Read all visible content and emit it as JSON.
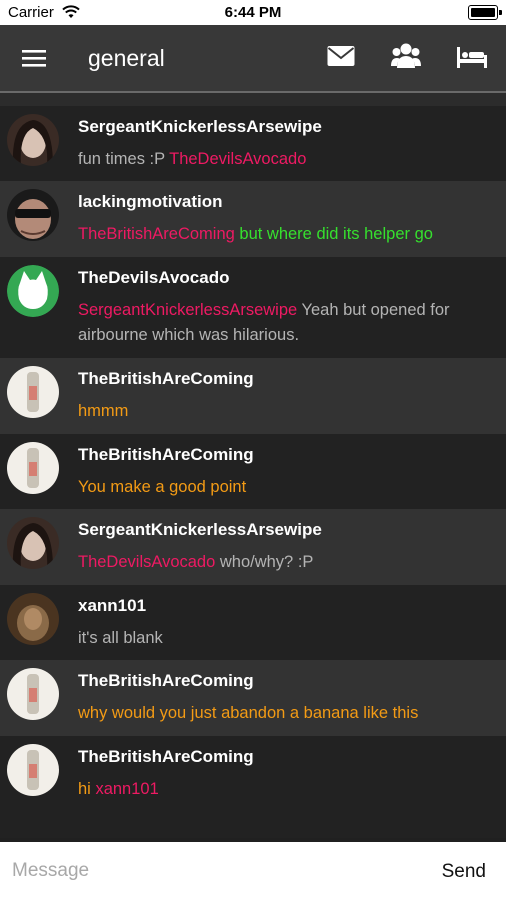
{
  "status_bar": {
    "carrier": "Carrier",
    "time": "6:44 PM"
  },
  "header": {
    "title": "general",
    "icons": [
      "menu-icon",
      "mail-icon",
      "users-icon",
      "bed-icon"
    ]
  },
  "colors": {
    "mention": "#ee1a63",
    "green": "#36e02e",
    "orange": "#f39b15",
    "text": "#b4b4b4"
  },
  "messages": [
    {
      "username": "SergeantKnickerlessArsewipe",
      "avatar": "dark-hair-photo",
      "parts": [
        {
          "text": "fun times :P ",
          "style": "gray"
        },
        {
          "text": "TheDevilsAvocado",
          "style": "pink"
        }
      ]
    },
    {
      "username": "lackingmotivation",
      "avatar": "sunglasses-photo",
      "parts": [
        {
          "text": "TheBritishAreComing",
          "style": "pink"
        },
        {
          "text": " but where did its helper go",
          "style": "green"
        }
      ]
    },
    {
      "username": "TheDevilsAvocado",
      "avatar": "green-cat-logo",
      "parts": [
        {
          "text": "SergeantKnickerlessArsewipe",
          "style": "pink"
        },
        {
          "text": " Yeah but opened for airbourne which was hilarious.",
          "style": "gray"
        }
      ]
    },
    {
      "username": "TheBritishAreComing",
      "avatar": "bottle-photo",
      "parts": [
        {
          "text": "hmmm",
          "style": "orange"
        }
      ]
    },
    {
      "username": "TheBritishAreComing",
      "avatar": "bottle-photo",
      "parts": [
        {
          "text": "You make a good point",
          "style": "orange"
        }
      ]
    },
    {
      "username": "SergeantKnickerlessArsewipe",
      "avatar": "dark-hair-photo",
      "parts": [
        {
          "text": "TheDevilsAvocado",
          "style": "pink"
        },
        {
          "text": " who/why? :P",
          "style": "gray"
        }
      ]
    },
    {
      "username": "xann101",
      "avatar": "brown-photo",
      "parts": [
        {
          "text": "it's all blank",
          "style": "gray"
        }
      ]
    },
    {
      "username": "TheBritishAreComing",
      "avatar": "bottle-photo",
      "parts": [
        {
          "text": "why would you just abandon a banana like this",
          "style": "orange"
        }
      ]
    },
    {
      "username": "TheBritishAreComing",
      "avatar": "bottle-photo",
      "parts": [
        {
          "text": "hi ",
          "style": "orange"
        },
        {
          "text": "xann101",
          "style": "pink"
        }
      ]
    }
  ],
  "composer": {
    "placeholder": "Message",
    "send_label": "Send"
  }
}
